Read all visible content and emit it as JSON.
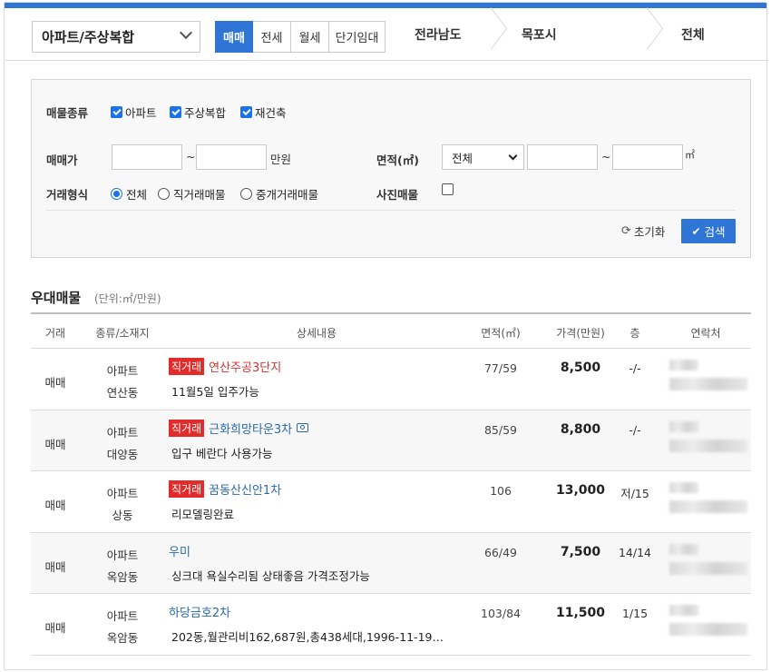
{
  "header": {
    "property_type": "아파트/주상복합",
    "deal_tabs": [
      {
        "label": "매매",
        "active": true
      },
      {
        "label": "전세",
        "active": false
      },
      {
        "label": "월세",
        "active": false
      },
      {
        "label": "단기임대",
        "active": false
      }
    ],
    "breadcrumbs": [
      "전라남도",
      "목포시",
      "전체"
    ]
  },
  "filter": {
    "kind_label": "매물종류",
    "kind_options": [
      {
        "label": "아파트",
        "checked": true
      },
      {
        "label": "주상복합",
        "checked": true
      },
      {
        "label": "재건축",
        "checked": true
      }
    ],
    "price_label": "매매가",
    "price_min": "",
    "price_max": "",
    "range_sep": "~",
    "price_unit": "만원",
    "area_label": "면적(㎡)",
    "area_select": "전체",
    "area_min": "",
    "area_max": "",
    "area_unit": "㎡",
    "trade_label": "거래형식",
    "trade_options": [
      {
        "label": "전체",
        "selected": true
      },
      {
        "label": "직거래매물",
        "selected": false
      },
      {
        "label": "중개거래매물",
        "selected": false
      }
    ],
    "photo_label": "사진매물",
    "photo_checked": false,
    "reset_label": "초기화",
    "search_label": "검색"
  },
  "section": {
    "title": "우대매물",
    "unit": "(단위:㎡/만원)"
  },
  "table": {
    "headers": [
      "거래",
      "종류/소재지",
      "상세내용",
      "면적(㎡)",
      "가격(만원)",
      "층",
      "연락처"
    ],
    "rows": [
      {
        "deal": "매매",
        "type": "아파트",
        "location": "연산동",
        "badge": "직거래",
        "title": "연산주공3단지",
        "desc": "11월5일 입주가능",
        "area": "77/59",
        "price": "8,500",
        "floor": "-/-",
        "camera": false,
        "title_color": "red"
      },
      {
        "deal": "매매",
        "type": "아파트",
        "location": "대양동",
        "badge": "직거래",
        "title": "근화희망타운3차",
        "desc": "입구 베란다 사용가능",
        "area": "85/59",
        "price": "8,800",
        "floor": "-/-",
        "camera": true,
        "title_color": "blue"
      },
      {
        "deal": "매매",
        "type": "아파트",
        "location": "상동",
        "badge": "직거래",
        "title": "꿈동산신안1차",
        "desc": "리모델링완료",
        "area": "106",
        "price": "13,000",
        "floor": "저/15",
        "camera": false,
        "title_color": "blue"
      },
      {
        "deal": "매매",
        "type": "아파트",
        "location": "옥암동",
        "badge": "",
        "title": "우미",
        "desc": "싱크대 욕실수리됨 상태좋음 가격조정가능",
        "area": "66/49",
        "price": "7,500",
        "floor": "14/14",
        "camera": false,
        "title_color": "blue"
      },
      {
        "deal": "매매",
        "type": "아파트",
        "location": "옥암동",
        "badge": "",
        "title": "하당금호2차",
        "desc": "202동,월관리비162,687원,총438세대,1996-11-19…",
        "area": "103/84",
        "price": "11,500",
        "floor": "1/15",
        "camera": false,
        "title_color": "blue"
      }
    ]
  },
  "colors": {
    "accent": "#2e75d5",
    "badge": "#e12c2c",
    "title_blue": "#2a6aa8",
    "title_red": "#d9322f"
  }
}
